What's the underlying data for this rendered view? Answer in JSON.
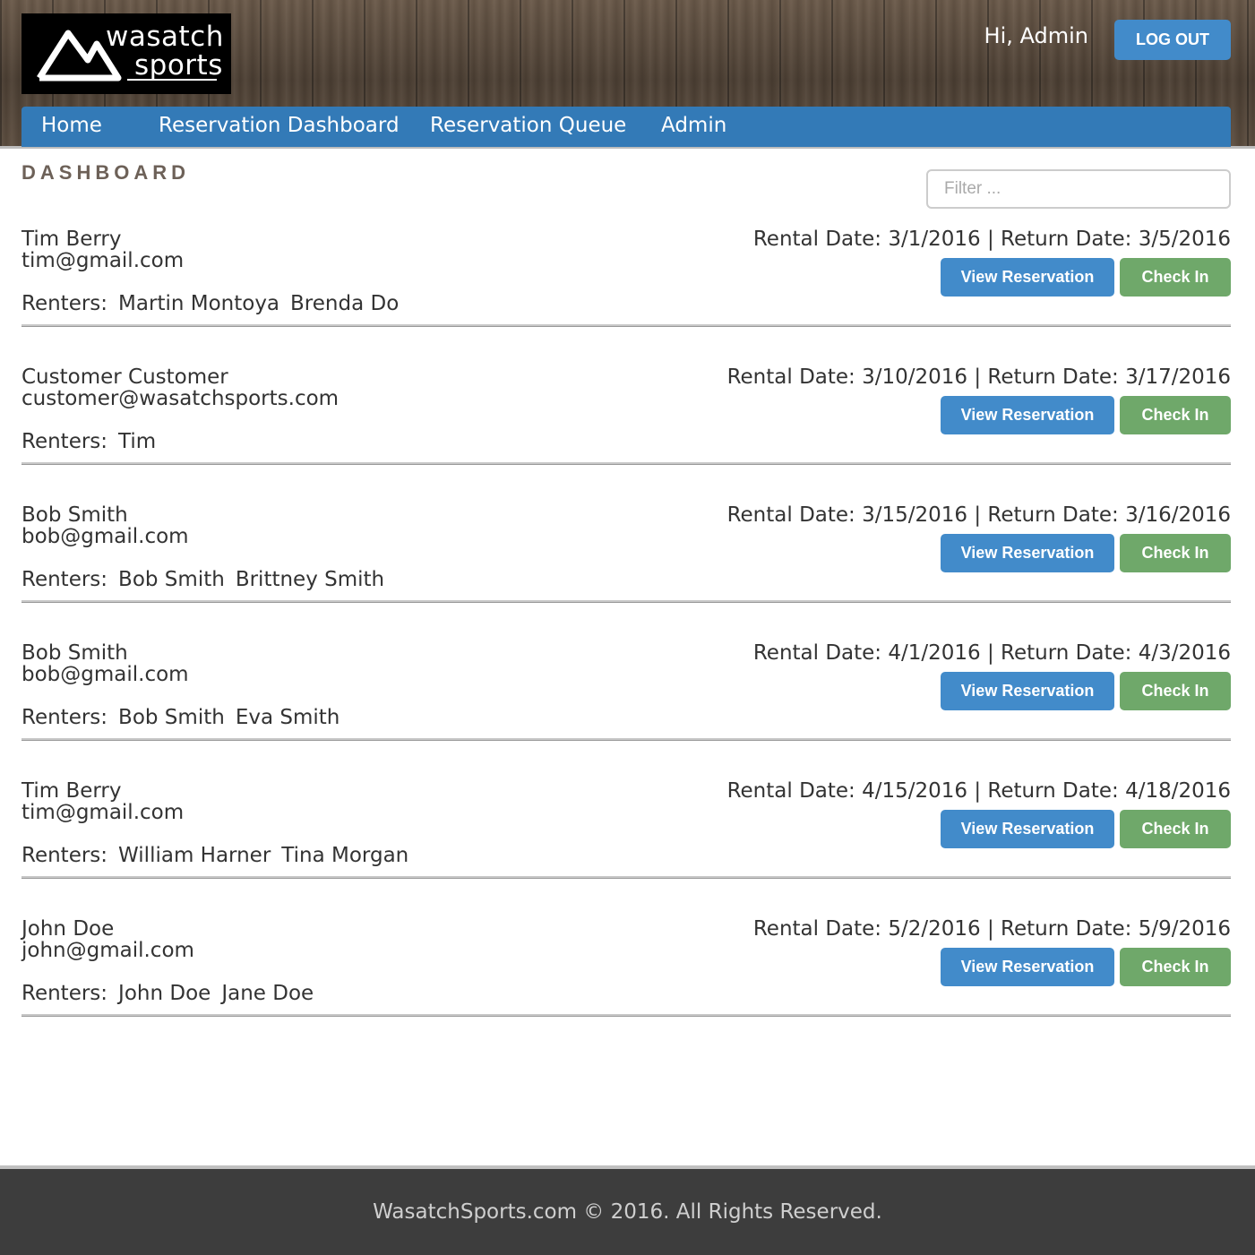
{
  "header": {
    "logo_line1": "wasatch",
    "logo_line2": "sports",
    "greeting": "Hi, Admin",
    "logout_label": "LOG OUT"
  },
  "nav": {
    "items": [
      {
        "label": "Home"
      },
      {
        "label": "Reservation Dashboard"
      },
      {
        "label": "Reservation Queue"
      },
      {
        "label": "Admin"
      }
    ]
  },
  "main": {
    "title": "DASHBOARD",
    "filter_placeholder": "Filter ..."
  },
  "buttons": {
    "view_label": "View Reservation",
    "check_in_label": "Check In"
  },
  "reservations": [
    {
      "name": "Tim Berry",
      "email": "tim@gmail.com",
      "renters_label": "Renters:",
      "renters": [
        "Martin Montoya",
        "Brenda Do"
      ],
      "dates": "Rental Date: 3/1/2016 | Return Date: 3/5/2016"
    },
    {
      "name": "Customer Customer",
      "email": "customer@wasatchsports.com",
      "renters_label": "Renters:",
      "renters": [
        "Tim"
      ],
      "dates": "Rental Date: 3/10/2016 | Return Date: 3/17/2016"
    },
    {
      "name": "Bob Smith",
      "email": "bob@gmail.com",
      "renters_label": "Renters:",
      "renters": [
        "Bob Smith",
        "Brittney Smith"
      ],
      "dates": "Rental Date: 3/15/2016 | Return Date: 3/16/2016"
    },
    {
      "name": "Bob Smith",
      "email": "bob@gmail.com",
      "renters_label": "Renters:",
      "renters": [
        "Bob Smith",
        "Eva Smith"
      ],
      "dates": "Rental Date: 4/1/2016 | Return Date: 4/3/2016"
    },
    {
      "name": "Tim Berry",
      "email": "tim@gmail.com",
      "renters_label": "Renters:",
      "renters": [
        "William Harner",
        "Tina Morgan"
      ],
      "dates": "Rental Date: 4/15/2016 | Return Date: 4/18/2016"
    },
    {
      "name": "John Doe",
      "email": "john@gmail.com",
      "renters_label": "Renters:",
      "renters": [
        "John Doe",
        "Jane Doe"
      ],
      "dates": "Rental Date: 5/2/2016 | Return Date: 5/9/2016"
    }
  ],
  "footer": {
    "text": "WasatchSports.com © 2016. All Rights Reserved."
  },
  "colors": {
    "primary_blue": "#337ab7",
    "button_blue": "#428bca",
    "check_in_green": "#6fa86a",
    "footer_bg": "#3d3d3d"
  }
}
